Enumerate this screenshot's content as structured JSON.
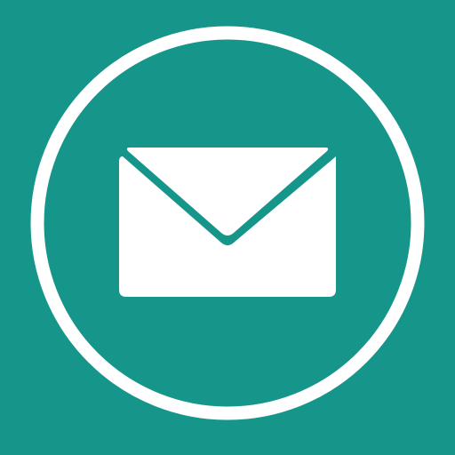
{
  "icon": {
    "name": "mail-icon",
    "background_color": "#16958a",
    "foreground_color": "#ffffff"
  }
}
